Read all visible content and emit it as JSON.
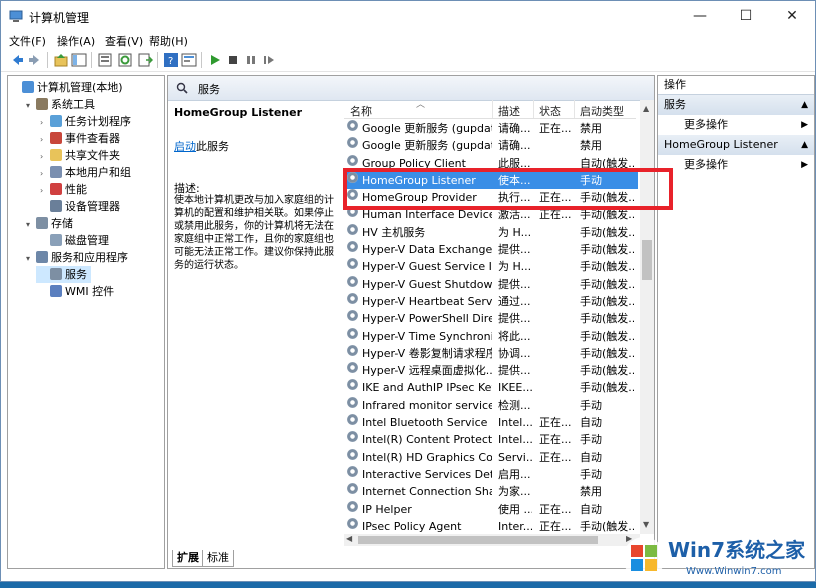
{
  "window": {
    "title": "计算机管理",
    "controls": [
      "—",
      "☐",
      "✕"
    ]
  },
  "menu": [
    "文件(F)",
    "操作(A)",
    "查看(V)",
    "帮助(H)"
  ],
  "toolbar_icons": [
    "back-icon",
    "forward-icon",
    "up-icon",
    "show-tree-icon",
    "export-icon",
    "refresh-icon",
    "export-list-icon",
    "help-icon",
    "properties-icon",
    "play-icon",
    "stop-icon",
    "pause-icon",
    "restart-icon"
  ],
  "tree": [
    {
      "label": "计算机管理(本地)",
      "level": 0,
      "expand": "",
      "icon": "computer"
    },
    {
      "label": "系统工具",
      "level": 1,
      "expand": "▾",
      "icon": "tools"
    },
    {
      "label": "任务计划程序",
      "level": 2,
      "expand": "›",
      "icon": "clock"
    },
    {
      "label": "事件查看器",
      "level": 2,
      "expand": "›",
      "icon": "event"
    },
    {
      "label": "共享文件夹",
      "level": 2,
      "expand": "›",
      "icon": "folder"
    },
    {
      "label": "本地用户和组",
      "level": 2,
      "expand": "›",
      "icon": "users"
    },
    {
      "label": "性能",
      "level": 2,
      "expand": "›",
      "icon": "perf"
    },
    {
      "label": "设备管理器",
      "level": 2,
      "expand": "",
      "icon": "device"
    },
    {
      "label": "存储",
      "level": 1,
      "expand": "▾",
      "icon": "storage"
    },
    {
      "label": "磁盘管理",
      "level": 2,
      "expand": "",
      "icon": "disk"
    },
    {
      "label": "服务和应用程序",
      "level": 1,
      "expand": "▾",
      "icon": "services-app"
    },
    {
      "label": "服务",
      "level": 2,
      "expand": "",
      "icon": "gear",
      "selected": true
    },
    {
      "label": "WMI 控件",
      "level": 2,
      "expand": "",
      "icon": "wmi"
    }
  ],
  "center": {
    "header": "服务",
    "selected_name": "HomeGroup Listener",
    "start_link": "启动",
    "start_suffix": "此服务",
    "desc_label": "描述:",
    "desc_text": "使本地计算机更改与加入家庭组的计算机的配置和维护相关联。如果停止或禁用此服务，你的计算机将无法在家庭组中正常工作，且你的家庭组也可能无法正常工作。建议你保持此服务的运行状态。",
    "columns": [
      "名称",
      "描述",
      "状态",
      "启动类型"
    ],
    "tabs": [
      "扩展",
      "标准"
    ]
  },
  "services": [
    {
      "name": "Google 更新服务 (gupdate)",
      "desc": "请确...",
      "status": "正在...",
      "start": "禁用"
    },
    {
      "name": "Google 更新服务 (gupdatem)",
      "desc": "请确...",
      "status": "",
      "start": "禁用"
    },
    {
      "name": "Group Policy Client",
      "desc": "此服...",
      "status": "",
      "start": "自动(触发..."
    },
    {
      "name": "HomeGroup Listener",
      "desc": "使本...",
      "status": "",
      "start": "手动",
      "selected": true
    },
    {
      "name": "HomeGroup Provider",
      "desc": "执行...",
      "status": "正在...",
      "start": "手动(触发..."
    },
    {
      "name": "Human Interface Device ...",
      "desc": "激活...",
      "status": "正在...",
      "start": "手动(触发..."
    },
    {
      "name": "HV 主机服务",
      "desc": "为 H...",
      "status": "",
      "start": "手动(触发..."
    },
    {
      "name": "Hyper-V Data Exchange ...",
      "desc": "提供...",
      "status": "",
      "start": "手动(触发..."
    },
    {
      "name": "Hyper-V Guest Service In...",
      "desc": "为 H...",
      "status": "",
      "start": "手动(触发..."
    },
    {
      "name": "Hyper-V Guest Shutdown...",
      "desc": "提供...",
      "status": "",
      "start": "手动(触发..."
    },
    {
      "name": "Hyper-V Heartbeat Service",
      "desc": "通过...",
      "status": "",
      "start": "手动(触发..."
    },
    {
      "name": "Hyper-V PowerShell Dire...",
      "desc": "提供...",
      "status": "",
      "start": "手动(触发..."
    },
    {
      "name": "Hyper-V Time Synchroniz...",
      "desc": "将此...",
      "status": "",
      "start": "手动(触发..."
    },
    {
      "name": "Hyper-V 卷影复制请求程序",
      "desc": "协调...",
      "status": "",
      "start": "手动(触发..."
    },
    {
      "name": "Hyper-V 远程桌面虚拟化...",
      "desc": "提供...",
      "status": "",
      "start": "手动(触发..."
    },
    {
      "name": "IKE and AuthIP IPsec Key...",
      "desc": "IKEE...",
      "status": "",
      "start": "手动(触发..."
    },
    {
      "name": "Infrared monitor service",
      "desc": "检测...",
      "status": "",
      "start": "手动"
    },
    {
      "name": "Intel Bluetooth Service",
      "desc": "Intel...",
      "status": "正在...",
      "start": "自动"
    },
    {
      "name": "Intel(R) Content Protectio...",
      "desc": "Intel...",
      "status": "正在...",
      "start": "手动"
    },
    {
      "name": "Intel(R) HD Graphics Con...",
      "desc": "Servi...",
      "status": "正在...",
      "start": "自动"
    },
    {
      "name": "Interactive Services Dete...",
      "desc": "启用...",
      "status": "",
      "start": "手动"
    },
    {
      "name": "Internet Connection Shari...",
      "desc": "为家...",
      "status": "",
      "start": "禁用"
    },
    {
      "name": "IP Helper",
      "desc": "使用 ...",
      "status": "正在...",
      "start": "自动"
    },
    {
      "name": "IPsec Policy Agent",
      "desc": "Inter...",
      "status": "正在...",
      "start": "手动(触发..."
    }
  ],
  "actions": {
    "title": "操作",
    "sections": [
      {
        "label": "服务",
        "item": "更多操作"
      },
      {
        "label": "HomeGroup Listener",
        "item": "更多操作"
      }
    ]
  },
  "watermark": {
    "brand": "Win7系统之家",
    "url": "Www.Winwin7.com"
  }
}
